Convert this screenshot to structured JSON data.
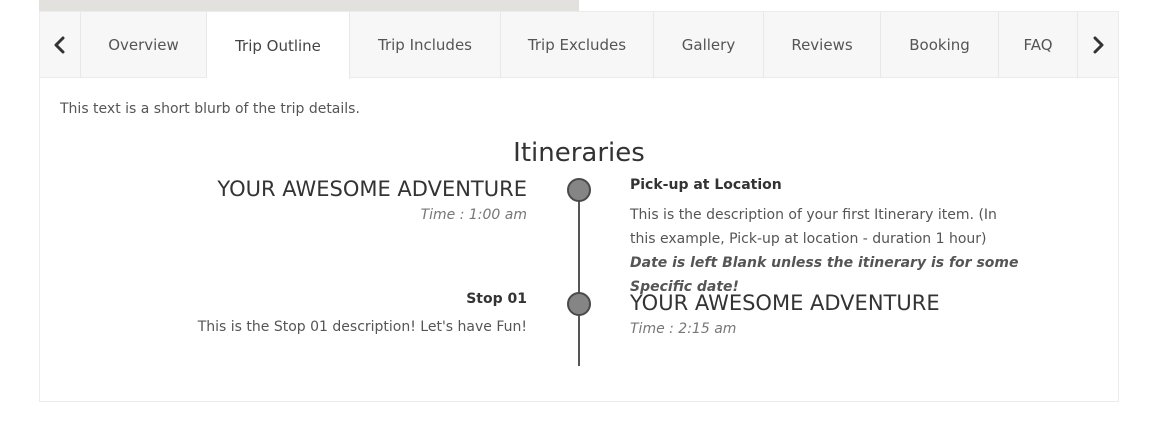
{
  "tabs": {
    "prev_icon": "chevron-left-icon",
    "next_icon": "chevron-right-icon",
    "items": [
      {
        "label": "Overview",
        "active": false
      },
      {
        "label": "Trip Outline",
        "active": true
      },
      {
        "label": "Trip Includes",
        "active": false
      },
      {
        "label": "Trip Excludes",
        "active": false
      },
      {
        "label": "Gallery",
        "active": false
      },
      {
        "label": "Reviews",
        "active": false
      },
      {
        "label": "Booking",
        "active": false
      },
      {
        "label": "FAQ",
        "active": false
      }
    ]
  },
  "content": {
    "blurb": "This text is a short blurb of the trip details.",
    "itineraries_title": "Itineraries",
    "items": [
      {
        "heading": "YOUR AWESOME ADVENTURE",
        "time": "Time : 1:00 am",
        "title": "Pick-up at Location",
        "description": "This is the description of your first Itinerary item. (In this example, Pick-up at location - duration 1 hour)",
        "description_emphasis": "Date is left Blank unless the itinerary is for some Specific date!"
      },
      {
        "heading": "YOUR AWESOME ADVENTURE",
        "time": "Time : 2:15 am",
        "title": "Stop 01",
        "description": "This is the Stop 01 description! Let's have Fun!"
      }
    ]
  },
  "colors": {
    "tab_bar_bg": "#f7f7f7",
    "active_tab_bg": "#ffffff",
    "timeline_dot": "#858585",
    "timeline_line": "#555555"
  }
}
